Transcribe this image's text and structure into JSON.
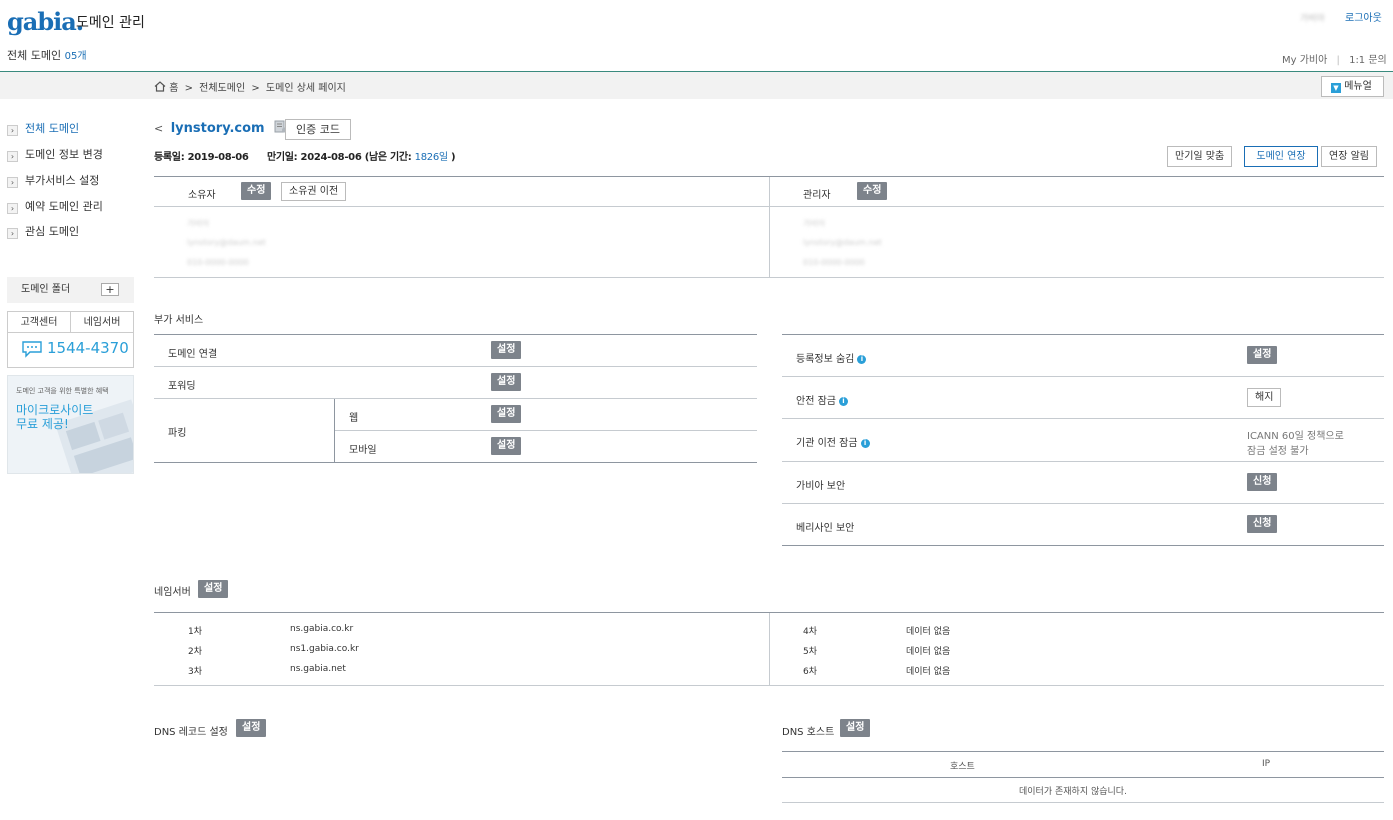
{
  "header": {
    "logo": "gabia.",
    "title": "도메인 관리",
    "user_name": "가비아",
    "logout": "로그아웃",
    "domain_count_label": "전체 도메인",
    "domain_count": "05개",
    "my_gabia": "My 가비아",
    "divider": "|",
    "qna": "1:1 문의"
  },
  "breadcrumb": {
    "home": "홈",
    "sep1": ">",
    "item1": "전체도메인",
    "sep2": ">",
    "item2": "도메인 상세 페이지",
    "manual": "메뉴얼"
  },
  "sidebar": {
    "items": [
      {
        "label": "전체 도메인"
      },
      {
        "label": "도메인 정보 변경"
      },
      {
        "label": "부가서비스 설정"
      },
      {
        "label": "예약 도메인 관리"
      },
      {
        "label": "관심 도메인"
      }
    ],
    "folder_label": "도메인 폴더",
    "folder_add": "+",
    "tabs": [
      "고객센터",
      "네임서버"
    ],
    "phone": "1544-4370",
    "banner_small": "도메인 고객을 위한 특별한 혜택",
    "banner_line1": "마이크로사이트",
    "banner_line2": "무료 제공!"
  },
  "domain": {
    "back": "<",
    "name": "lynstory.com",
    "auth_code": "인증 코드",
    "reg_label": "등록일:",
    "reg_date": "2019-08-06",
    "exp_label": "만기일:",
    "exp_date": "2024-08-06",
    "remain_prefix": "(남은 기간:",
    "remain_days": "1826일",
    "remain_suffix": ")",
    "btn_expiry_match": "만기일 맞춤",
    "btn_renew": "도메인 연장",
    "btn_alert": "연장 알림"
  },
  "contacts": {
    "owner_label": "소유자",
    "owner_edit": "수정",
    "owner_transfer": "소유권 이전",
    "admin_label": "관리자",
    "admin_edit": "수정",
    "owner_name": "가비아",
    "owner_email": "lynstory@daum.net",
    "owner_phone": "010-0000-0000",
    "admin_name": "가비아",
    "admin_email": "lynstory@daum.net",
    "admin_phone": "010-0000-0000"
  },
  "addon": {
    "title": "부가 서비스",
    "domain_connect": "도메인 연결",
    "forwarding": "포워딩",
    "parking": "파킹",
    "web": "웹",
    "mobile": "모바일",
    "set": "설정",
    "privacy": "등록정보 숨김",
    "safe_lock": "안전 잠금",
    "transfer_lock": "기관 이전 잠금",
    "gabia_security": "가비아 보안",
    "verisign_security": "베리사인 보안",
    "release": "해지",
    "apply": "신청",
    "icann_line1": "ICANN 60일 정책으로",
    "icann_line2": "잠금 설정 불가"
  },
  "nameserver": {
    "title": "네임서버",
    "set": "설정",
    "rows_left": [
      {
        "rank": "1차",
        "host": "ns.gabia.co.kr"
      },
      {
        "rank": "2차",
        "host": "ns1.gabia.co.kr"
      },
      {
        "rank": "3차",
        "host": "ns.gabia.net"
      }
    ],
    "rows_right": [
      {
        "rank": "4차",
        "host": "데이터 없음"
      },
      {
        "rank": "5차",
        "host": "데이터 없음"
      },
      {
        "rank": "6차",
        "host": "데이터 없음"
      }
    ]
  },
  "dns": {
    "record_title": "DNS 레코드 설정",
    "record_set": "설정",
    "host_title": "DNS 호스트",
    "host_set": "설정",
    "col_host": "호스트",
    "col_ip": "IP",
    "empty": "데이터가 존재하지 않습니다."
  },
  "colors": {
    "accent_blue": "#1a6eb5",
    "header_line": "#3a8a7e",
    "button_gray": "#7d838b",
    "info_icon": "#2a9fd8"
  }
}
